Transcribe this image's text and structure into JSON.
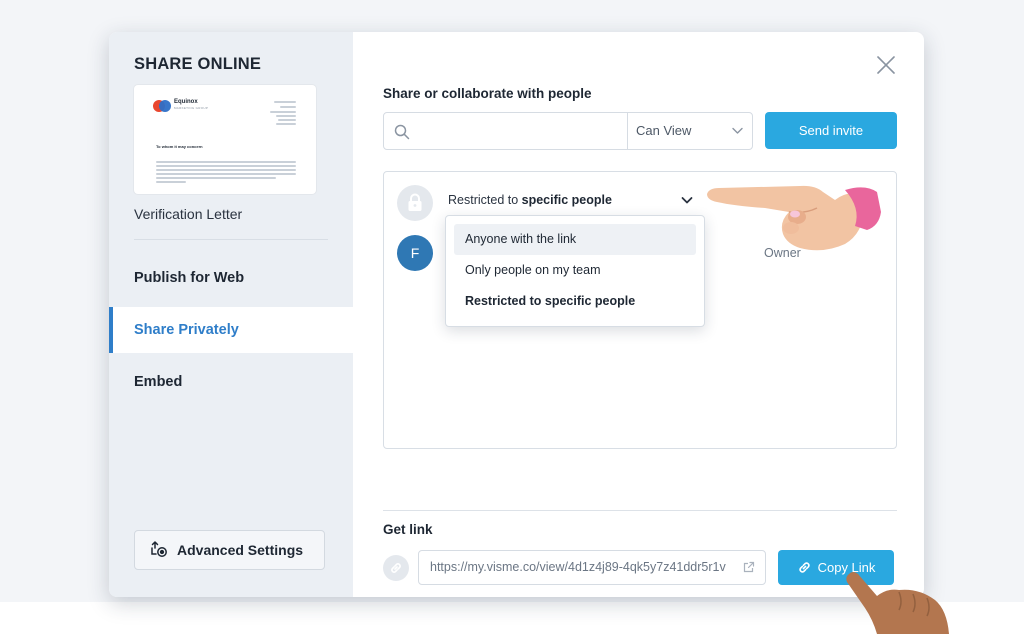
{
  "sidebar": {
    "title": "SHARE ONLINE",
    "thumbnail": {
      "brand": "Equinox",
      "subbrand": "MARKETING GROUP",
      "greeting": "To whom it may concern"
    },
    "document_name": "Verification Letter",
    "nav": [
      {
        "label": "Publish for Web",
        "active": false
      },
      {
        "label": "Share Privately",
        "active": true
      },
      {
        "label": "Embed",
        "active": false
      }
    ],
    "advanced_settings_label": "Advanced Settings"
  },
  "main": {
    "section_title": "Share or collaborate with people",
    "search": {
      "placeholder": "",
      "value": ""
    },
    "permission": {
      "selected": "Can View"
    },
    "send_invite_label": "Send invite",
    "access": {
      "prefix": "Restricted to ",
      "bold": "specific people"
    },
    "owner": {
      "initial": "F",
      "role": "Owner"
    },
    "dropdown_options": [
      "Anyone with the link",
      "Only people on my team",
      "Restricted to specific people"
    ],
    "get_link": {
      "title": "Get link",
      "url": "https://my.visme.co/view/4d1z4j89-4qk5y7z41ddr5r1v",
      "copy_label": "Copy Link"
    }
  },
  "colors": {
    "accent": "#2aa8e0",
    "active_nav": "#2f7ec9",
    "avatar": "#2f78b4",
    "sidebar_bg": "#ebeff4"
  },
  "icons": [
    "close-icon",
    "search-icon",
    "chevron-down-icon",
    "lock-icon",
    "link-icon",
    "external-link-icon",
    "settings-upload-icon"
  ]
}
